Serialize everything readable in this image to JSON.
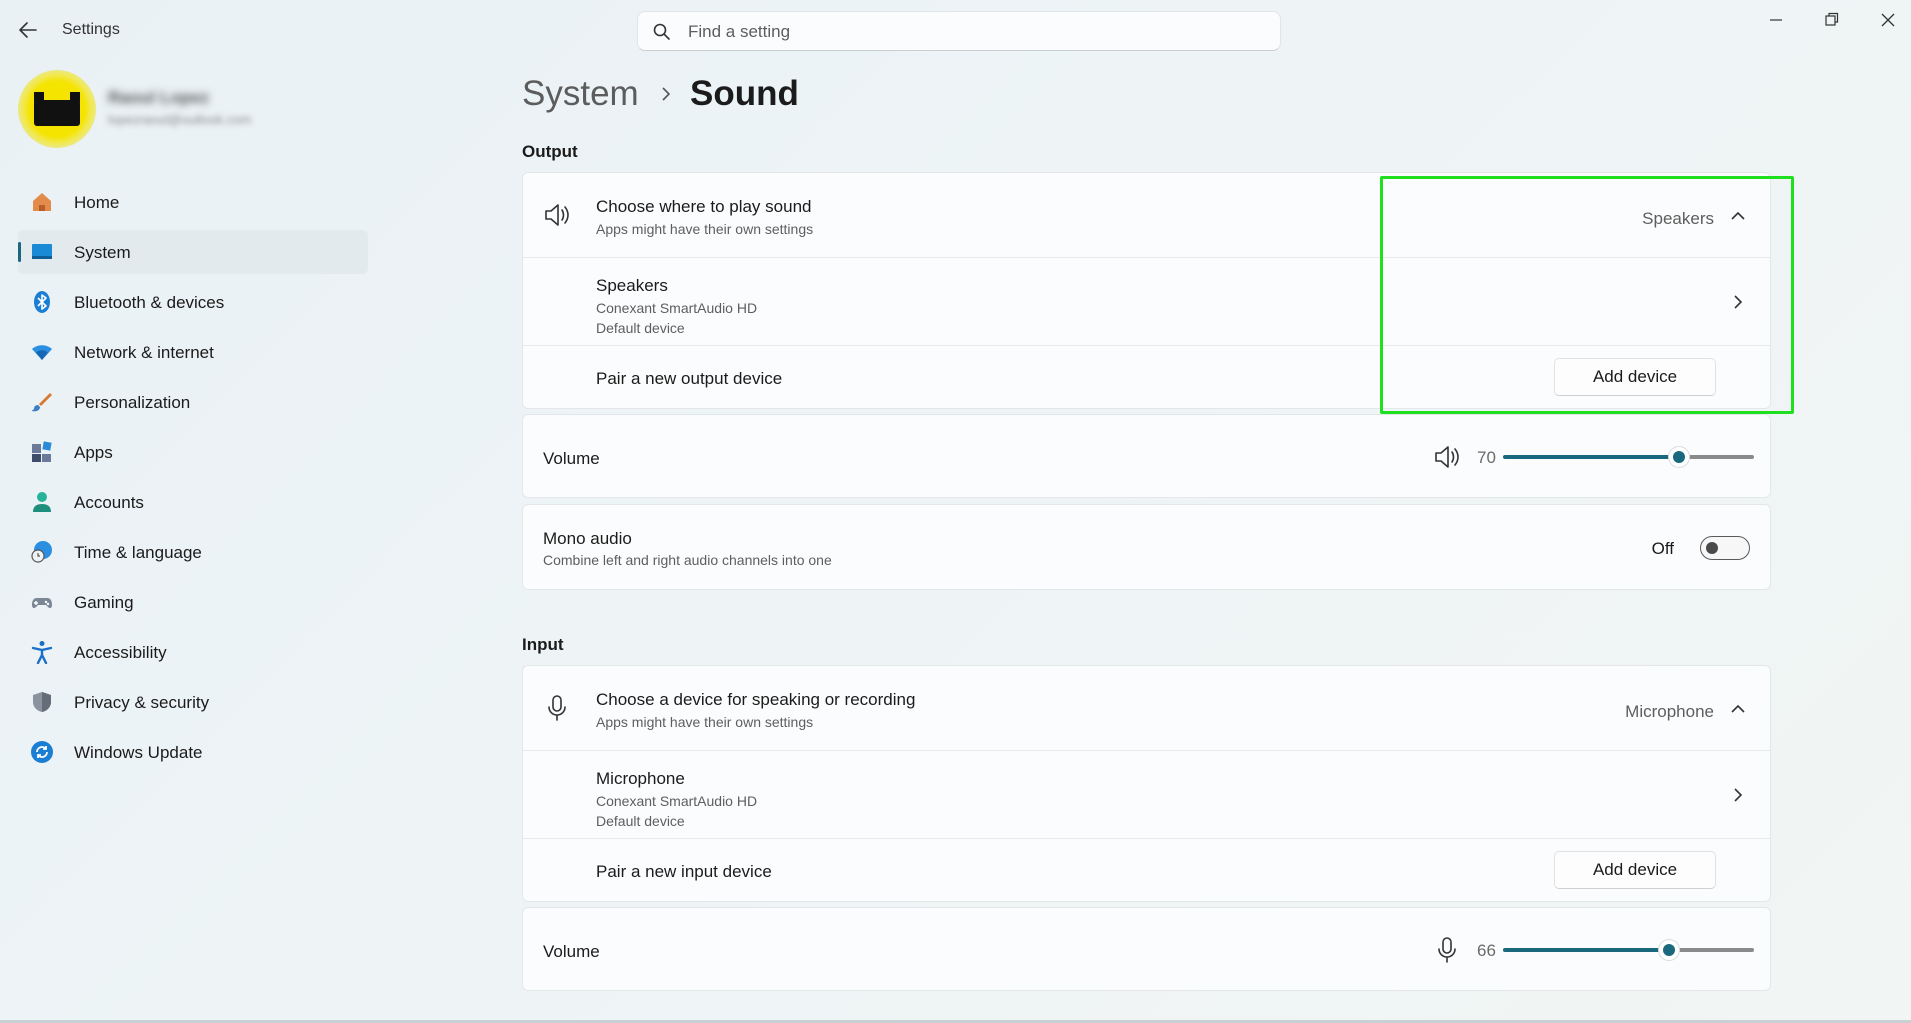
{
  "window": {
    "app_title": "Settings",
    "search_placeholder": "Find a setting"
  },
  "profile": {
    "name": "Raoul Lopez",
    "email": "lopezraoul@outlook.com"
  },
  "sidebar": {
    "items": [
      {
        "label": "Home",
        "icon": "home-icon",
        "active": false
      },
      {
        "label": "System",
        "icon": "system-icon",
        "active": true
      },
      {
        "label": "Bluetooth & devices",
        "icon": "bluetooth-icon",
        "active": false
      },
      {
        "label": "Network & internet",
        "icon": "wifi-icon",
        "active": false
      },
      {
        "label": "Personalization",
        "icon": "brush-icon",
        "active": false
      },
      {
        "label": "Apps",
        "icon": "apps-icon",
        "active": false
      },
      {
        "label": "Accounts",
        "icon": "person-icon",
        "active": false
      },
      {
        "label": "Time & language",
        "icon": "globe-clock-icon",
        "active": false
      },
      {
        "label": "Gaming",
        "icon": "gamepad-icon",
        "active": false
      },
      {
        "label": "Accessibility",
        "icon": "accessibility-icon",
        "active": false
      },
      {
        "label": "Privacy & security",
        "icon": "shield-icon",
        "active": false
      },
      {
        "label": "Windows Update",
        "icon": "update-icon",
        "active": false
      }
    ]
  },
  "breadcrumb": {
    "parent": "System",
    "current": "Sound"
  },
  "output": {
    "section_title": "Output",
    "choose": {
      "title": "Choose where to play sound",
      "subtitle": "Apps might have their own settings",
      "value": "Speakers"
    },
    "device": {
      "name": "Speakers",
      "driver": "Conexant SmartAudio HD",
      "status": "Default device"
    },
    "pair": {
      "label": "Pair a new output device",
      "button": "Add device"
    },
    "volume": {
      "label": "Volume",
      "value": 70,
      "value_text": "70"
    },
    "mono": {
      "title": "Mono audio",
      "subtitle": "Combine left and right audio channels into one",
      "state": "Off"
    }
  },
  "input": {
    "section_title": "Input",
    "choose": {
      "title": "Choose a device for speaking or recording",
      "subtitle": "Apps might have their own settings",
      "value": "Microphone"
    },
    "device": {
      "name": "Microphone",
      "driver": "Conexant SmartAudio HD",
      "status": "Default device"
    },
    "pair": {
      "label": "Pair a new input device",
      "button": "Add device"
    },
    "volume": {
      "label": "Volume",
      "value": 66,
      "value_text": "66"
    }
  },
  "colors": {
    "accent": "#19687d",
    "highlight": "#1ee01e"
  }
}
